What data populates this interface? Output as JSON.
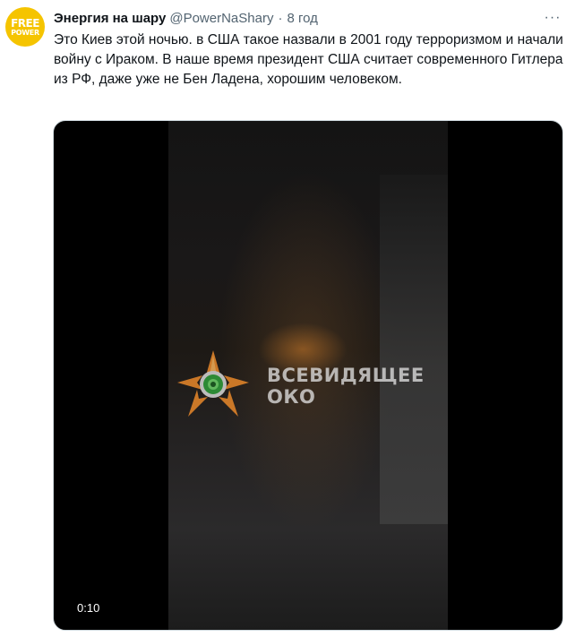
{
  "author": {
    "name": "Энергия на шару",
    "handle": "@PowerNaShary",
    "separator": "·",
    "time": "8 год",
    "avatar": {
      "line1": "FREE",
      "line2": "POWER",
      "color": "#f5c400"
    }
  },
  "tweet": {
    "text": "Это Киев этой ночью. в США такое назвали в 2001 году терроризмом и начали войну с Ираком. В наше время президент США считает современного Гитлера из РФ, даже уже не Бен Ладена, хорошим человеком."
  },
  "more_menu": {
    "icon": "more-horizontal-icon",
    "glyph": "···"
  },
  "media": {
    "type": "video",
    "duration": "0:10",
    "watermark": {
      "line1": "ВСЕВИДЯЩЕЕ",
      "line2": "ОКО",
      "icon": "star-eye-logo"
    }
  },
  "colors": {
    "name": "#0f1419",
    "secondary": "#536471",
    "media_border": "#cfd9de"
  }
}
